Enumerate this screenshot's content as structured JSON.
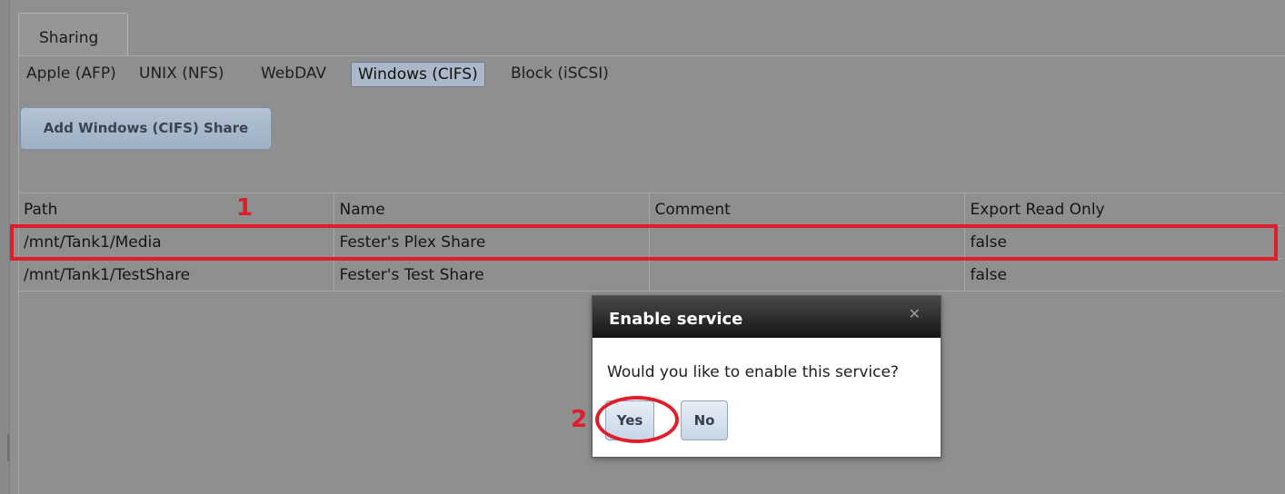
{
  "main_tab": {
    "label": "Sharing"
  },
  "subtabs": [
    {
      "label": "Apple (AFP)"
    },
    {
      "label": "UNIX (NFS)"
    },
    {
      "label": "WebDAV"
    },
    {
      "label": "Windows (CIFS)",
      "active": true
    },
    {
      "label": "Block (iSCSI)"
    }
  ],
  "toolbar": {
    "add_label": "Add Windows (CIFS) Share"
  },
  "table": {
    "columns": [
      "Path",
      "Name",
      "Comment",
      "Export Read Only"
    ],
    "rows": [
      {
        "path": "/mnt/Tank1/Media",
        "name": "Fester's Plex Share",
        "comment": "",
        "read_only": "false"
      },
      {
        "path": "/mnt/Tank1/TestShare",
        "name": "Fester's Test Share",
        "comment": "",
        "read_only": "false"
      }
    ]
  },
  "annotations": {
    "step1": "1",
    "step2": "2",
    "color": "#e01e2b"
  },
  "dialog": {
    "title": "Enable service",
    "message": "Would you like to enable this service?",
    "yes_label": "Yes",
    "no_label": "No",
    "close_icon": "close-icon"
  }
}
